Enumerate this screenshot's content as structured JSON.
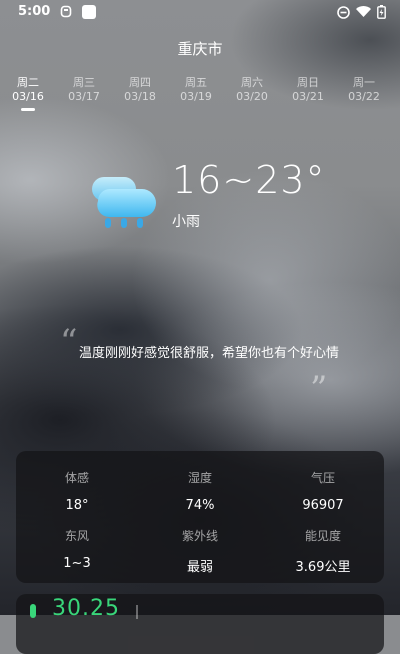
{
  "status_bar": {
    "time": "5:00"
  },
  "header": {
    "city": "重庆市"
  },
  "days": [
    {
      "weekday": "周二",
      "date": "03/16",
      "active": true
    },
    {
      "weekday": "周三",
      "date": "03/17"
    },
    {
      "weekday": "周四",
      "date": "03/18"
    },
    {
      "weekday": "周五",
      "date": "03/19"
    },
    {
      "weekday": "周六",
      "date": "03/20"
    },
    {
      "weekday": "周日",
      "date": "03/21"
    },
    {
      "weekday": "周一",
      "date": "03/22"
    }
  ],
  "current": {
    "temperature": "16~23°",
    "condition": "小雨",
    "icon": "cloud-rain-icon"
  },
  "quote": "温度刚刚好感觉很舒服，希望你也有个好心情",
  "details": [
    {
      "label": "体感",
      "value": "18°"
    },
    {
      "label": "湿度",
      "value": "74%"
    },
    {
      "label": "气压",
      "value": "96907"
    },
    {
      "label": "东风",
      "value": "1~3"
    },
    {
      "label": "紫外线",
      "value": "最弱"
    },
    {
      "label": "能见度",
      "value": "3.69公里"
    }
  ],
  "aqi": {
    "value": "30.25",
    "color": "#39d67a"
  }
}
